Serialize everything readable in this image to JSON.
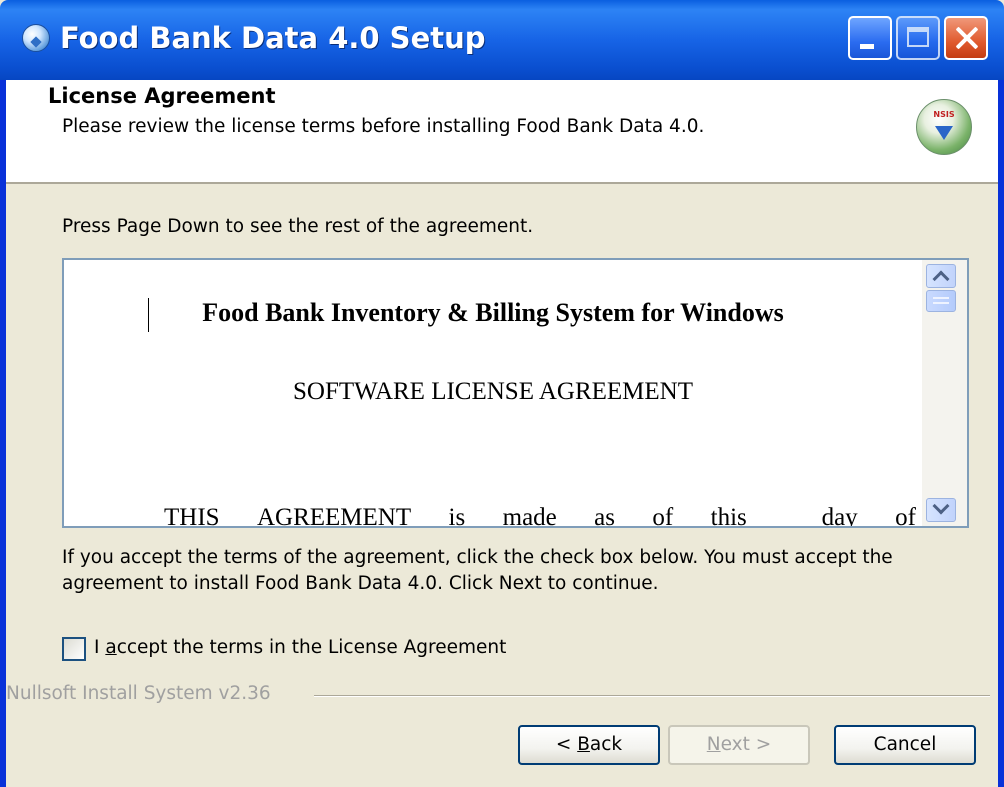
{
  "window": {
    "title": "Food Bank Data 4.0 Setup"
  },
  "header": {
    "title": "License Agreement",
    "subtitle": "Please review the license terms before installing Food Bank Data 4.0.",
    "logo_text": "NSIS"
  },
  "body": {
    "instruction_top": "Press Page Down to see the rest of the agreement.",
    "license_text": {
      "heading": "Food Bank Inventory & Billing System for Windows",
      "subheading": "SOFTWARE LICENSE AGREEMENT",
      "line_words": [
        "THIS",
        "AGREEMENT",
        "is",
        "made",
        "as",
        "of",
        "this",
        "",
        "day",
        "of"
      ]
    },
    "instruction_bottom_line1": "If you accept the terms of the agreement, click the check box below. You must accept the",
    "instruction_bottom_line2": "agreement to install Food Bank Data 4.0. Click Next to continue.",
    "checkbox": {
      "label_prefix": "I ",
      "label_access_key": "a",
      "label_rest": "ccept the terms in the License Agreement",
      "checked": false
    }
  },
  "footer": {
    "branding": "Nullsoft Install System v2.36"
  },
  "buttons": {
    "back": {
      "prefix": "< ",
      "access_key": "B",
      "rest": "ack"
    },
    "next": {
      "access_key": "N",
      "rest": "ext >",
      "enabled": false
    },
    "cancel": {
      "label": "Cancel"
    }
  },
  "colors": {
    "titlebar": "#0a5fe0",
    "dialog_bg": "#ece9d8",
    "frame": "#0831d9"
  }
}
